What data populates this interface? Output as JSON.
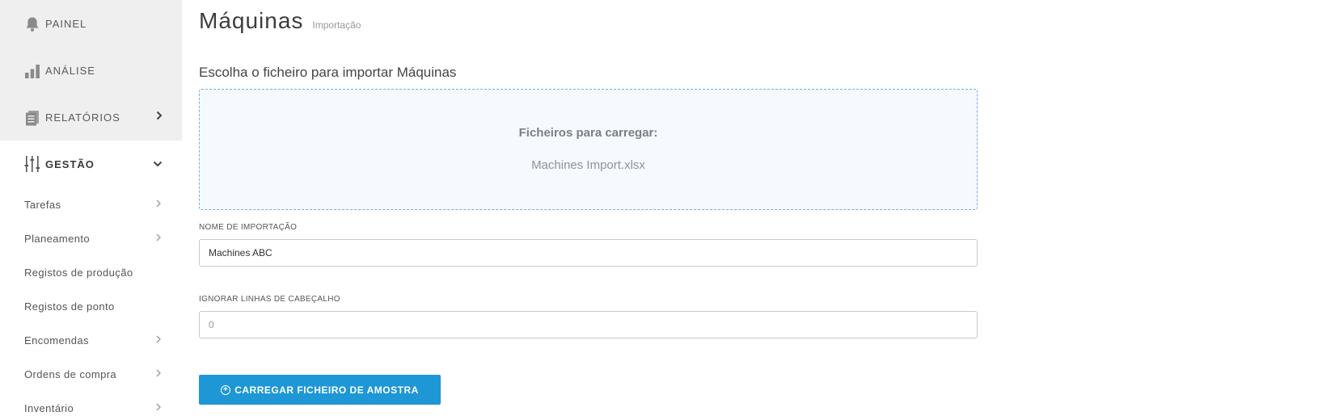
{
  "sidebar": {
    "main_items": [
      {
        "label": "PAINEL",
        "icon": "bell-icon"
      },
      {
        "label": "ANÁLISE",
        "icon": "bar-chart-icon"
      },
      {
        "label": "RELATÓRIOS",
        "icon": "document-icon"
      },
      {
        "label": "GESTÃO",
        "icon": "sliders-icon"
      }
    ],
    "sub_items": [
      {
        "label": "Tarefas"
      },
      {
        "label": "Planeamento"
      },
      {
        "label": "Registos de produção"
      },
      {
        "label": "Registos de ponto"
      },
      {
        "label": "Encomendas"
      },
      {
        "label": "Ordens de compra"
      },
      {
        "label": "Inventário"
      }
    ]
  },
  "page": {
    "title": "Máquinas",
    "subtitle": "Importação",
    "import_heading": "Escolha o ficheiro para importar Máquinas"
  },
  "dropzone": {
    "label": "Ficheiros para carregar:",
    "file_name": "Machines Import.xlsx"
  },
  "form": {
    "import_name_label": "NOME DE IMPORTAÇÃO",
    "import_name_value": "Machines ABC",
    "ignore_header_label": "IGNORAR LINHAS DE CABEÇALHO",
    "ignore_header_placeholder": "0"
  },
  "upload_button": {
    "label": "CARREGAR FICHEIRO DE AMOSTRA"
  },
  "colors": {
    "accent": "#1d97d5",
    "sidebar_bg": "#efefef",
    "dropzone_border": "#7aaee0"
  }
}
